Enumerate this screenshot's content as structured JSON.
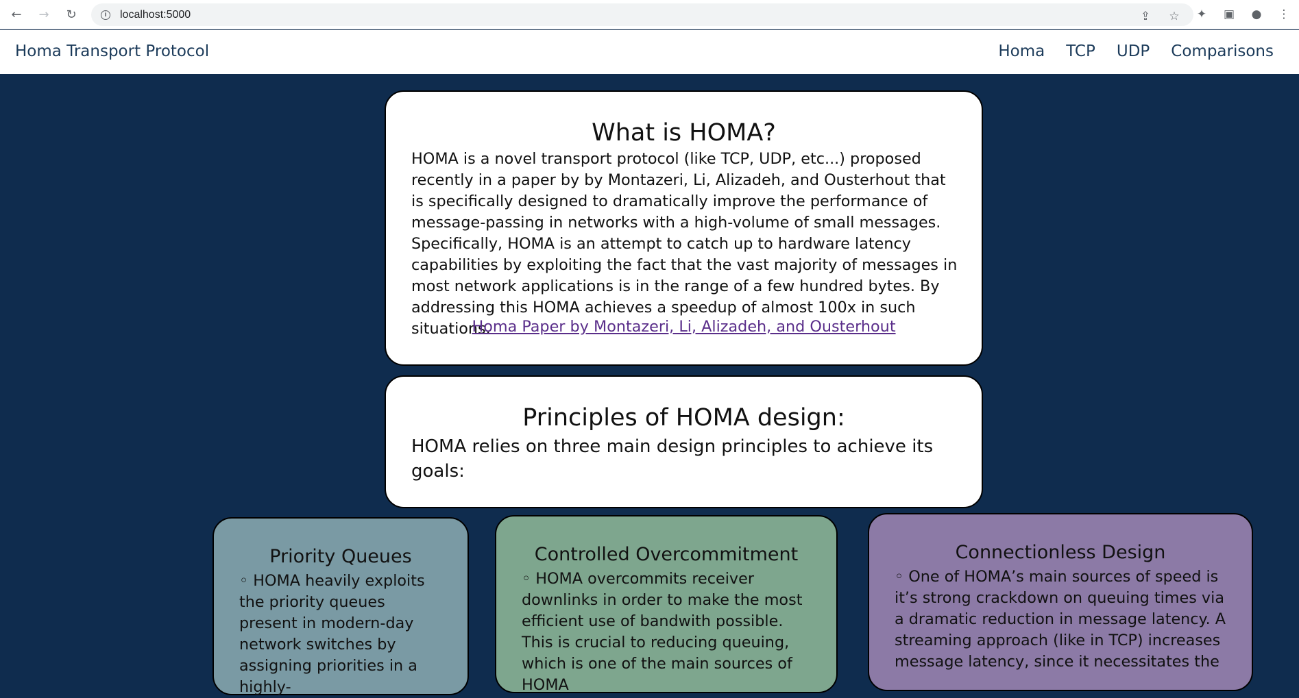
{
  "browser": {
    "url": "localhost:5000"
  },
  "navbar": {
    "brand": "Homa Transport Protocol",
    "links": [
      "Homa",
      "TCP",
      "UDP",
      "Comparisons"
    ]
  },
  "what_is": {
    "title": "What is HOMA?",
    "body": "HOMA is a novel transport protocol (like TCP, UDP, etc...) proposed recently in a paper by by Montazeri, Li, Alizadeh, and Ousterhout that is specifically designed to dramatically improve the performance of message-passing in networks with a high-volume of small messages. Specifically, HOMA is an attempt to catch up to hardware latency capabilities by exploiting the fact that the vast majority of messages in most network applications is in the range of a few hundred bytes. By addressing this HOMA achieves a speedup of almost 100x in such situations.",
    "link_text": "Homa Paper by Montazeri, Li, Alizadeh, and Ousterhout"
  },
  "principles": {
    "title": "Principles of HOMA design:",
    "body": "HOMA relies on three main design principles to achieve its goals:"
  },
  "cards": [
    {
      "title": "Priority Queues",
      "body": "◦ HOMA heavily exploits the priority queues present in modern-day network switches by assigning priorities in a highly-"
    },
    {
      "title": "Controlled Overcommitment",
      "body": "◦ HOMA overcommits receiver downlinks in order to make the most efficient use of bandwith possible. This is crucial to reducing queuing, which is one of the main sources of HOMA"
    },
    {
      "title": "Connectionless Design",
      "body": "◦ One of HOMA’s main sources of speed is it’s strong crackdown on queuing times via a dramatic reduction in message latency. A streaming approach (like in TCP) increases message latency, since it necessitates the"
    }
  ],
  "colors": {
    "page_bg": "#0f2c4e",
    "card_priority": "#7a9aa4",
    "card_overcommit": "#7ea68e",
    "card_connectionless": "#8c7aa6",
    "link": "#5a2e8a"
  }
}
